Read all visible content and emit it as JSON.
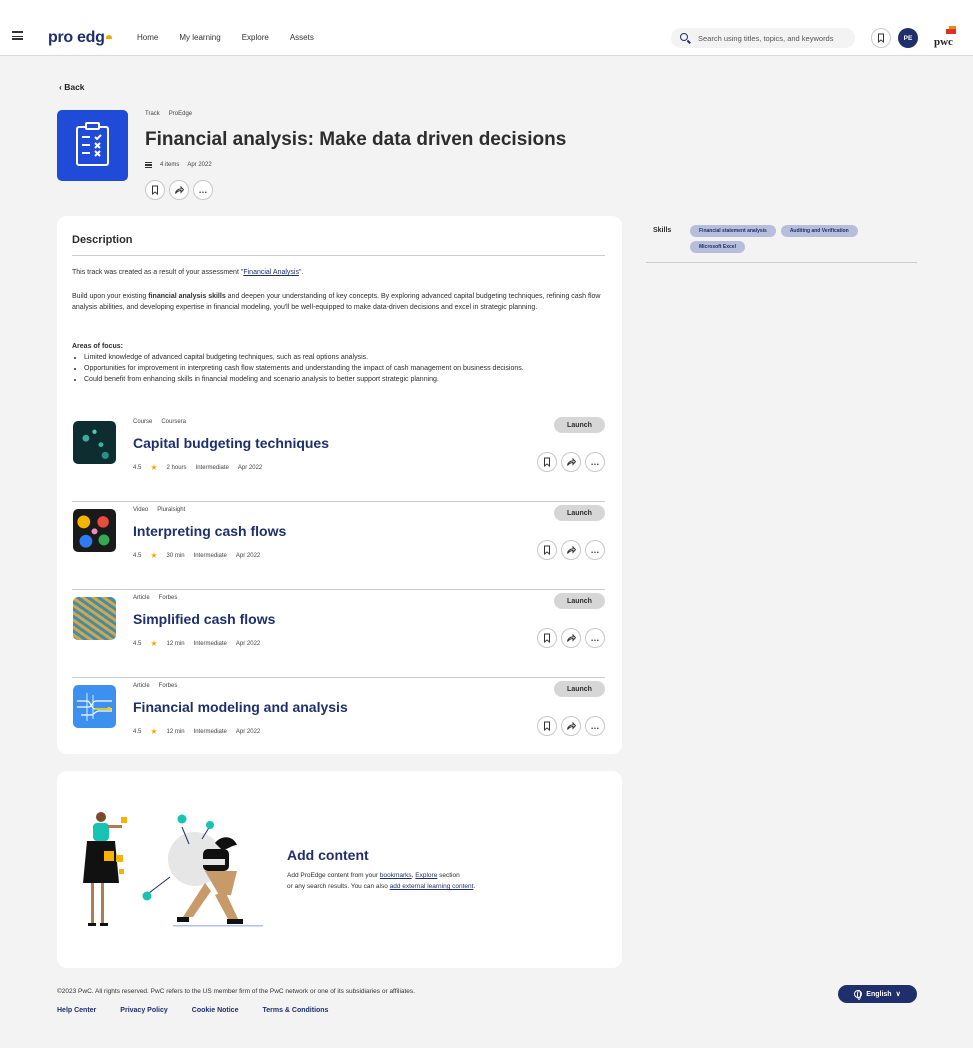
{
  "nav": {
    "logo": "pro edg",
    "links": [
      "Home",
      "My learning",
      "Explore",
      "Assets"
    ],
    "search_placeholder": "Search using titles, topics, and keywords",
    "avatar_initials": "PE",
    "brand": "pwc"
  },
  "back_label": "Back",
  "track": {
    "type": "Track",
    "provider": "ProEdge",
    "title": "Financial analysis: Make data driven decisions",
    "items": "4 items",
    "date": "Apr 2022"
  },
  "description": {
    "heading": "Description",
    "intro_prefix": "This track was created as a result of your assessment \"",
    "intro_link": "Financial Analysis",
    "intro_suffix": "\".",
    "body_before": "Build upon your existing ",
    "body_bold": "financial analysis skills",
    "body_after": " and deepen your understanding of key concepts. By exploring advanced capital budgeting techniques, refining cash flow analysis abilities, and developing expertise in financial modeling, you'll be well-equipped to make data-driven decisions and excel in strategic planning.",
    "focus_heading": "Areas of focus:",
    "focus_items": [
      "Limited knowledge of advanced capital budgeting techniques, such as real options analysis.",
      "Opportunities for improvement in interpreting cash flow statements and understanding the impact of cash management on business decisions.",
      "Could benefit from enhancing skills in financial modeling and scenario analysis to better support strategic planning."
    ]
  },
  "launch_label": "Launch",
  "items": [
    {
      "type": "Course",
      "provider": "Coursera",
      "title": "Capital budgeting techniques",
      "rating": "4.5",
      "duration": "2 hours",
      "level": "Intermediate",
      "date": "Apr 2022"
    },
    {
      "type": "Video",
      "provider": "Pluralsight",
      "title": "Interpreting cash flows",
      "rating": "4.5",
      "duration": "30 min",
      "level": "Intermediate",
      "date": "Apr 2022"
    },
    {
      "type": "Article",
      "provider": "Forbes",
      "title": "Simplified cash flows",
      "rating": "4.5",
      "duration": "12 min",
      "level": "Intermediate",
      "date": "Apr 2022"
    },
    {
      "type": "Article",
      "provider": "Forbes",
      "title": "Financial modeling and analysis",
      "rating": "4.5",
      "duration": "12 min",
      "level": "Intermediate",
      "date": "Apr 2022"
    }
  ],
  "skills": {
    "label": "Skills",
    "chips": [
      "Financial statement analysis",
      "Auditing and Verification",
      "Microsoft Excel"
    ]
  },
  "add_content": {
    "heading": "Add content",
    "line1_prefix": "Add ProEdge content from your ",
    "bookmarks_link": "bookmarks",
    "sep": ", ",
    "explore_link": "Explore",
    "line1_suffix": " section",
    "line2_prefix": "or any search results. You can also ",
    "external_link": "add external learning content",
    "line2_suffix": "."
  },
  "footer": {
    "copyright": "©2023 PwC. All rights reserved. PwC refers to the US member firm of the PwC network or one of its subsidiaries or affiliates.",
    "links": [
      "Help Center",
      "Privacy Policy",
      "Cookie Notice",
      "Terms & Conditions"
    ],
    "language": "English"
  },
  "colors": {
    "brand_navy": "#1f2f6b",
    "track_icon_blue": "#1f4bd8",
    "star": "#f5a800",
    "chip": "#b6bedb"
  }
}
